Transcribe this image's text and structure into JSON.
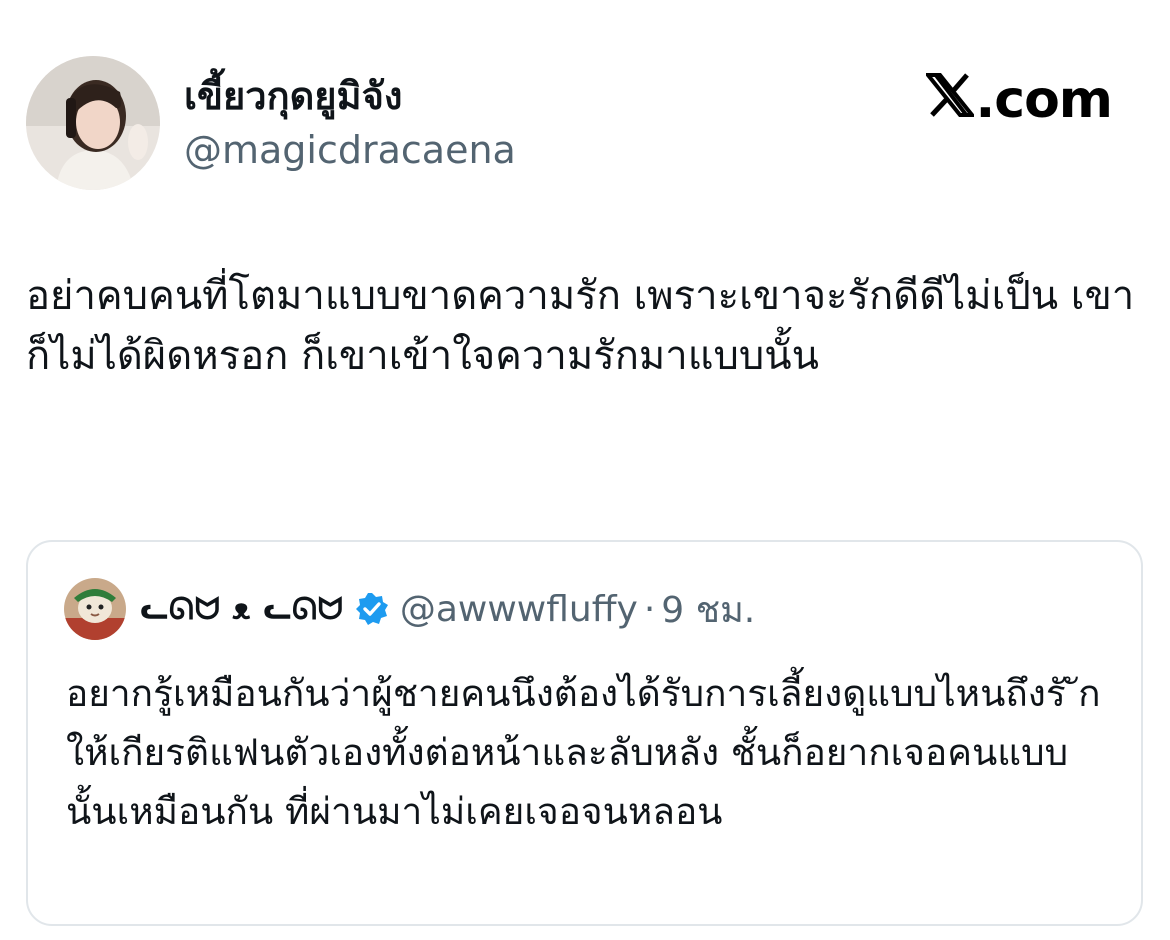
{
  "tweet": {
    "display_name": "เขี้ยวกุดยูมิจัง",
    "handle": "@magicdracaena",
    "source_label": ".com",
    "text": "อย่าคบคนที่โตมาแบบขาดความรัก เพราะเขาจะรักดีดีไม่เป็น เขาก็ไม่ได้ผิดหรอก ก็เขาเข้าใจความรักมาแบบนั้น"
  },
  "quoted_tweet": {
    "display_name": "ᓚᘏᗢ ᴥ ᓚᘏᗢ",
    "handle": "@awwwfluffy",
    "separator": "·",
    "time": "9 ชม.",
    "text": "อยากรู้เหมือนกันว่าผู้ชายคนนึงต้องได้รับการเลี้ยงดูแบบไหนถึงรั ัก ให้เกียรติแฟนตัวเองทั้งต่อหน้าและลับหลัง ชั้นก็อยากเจอคนแบบนั้นเหมือนกัน ที่ผ่านมาไม่เคยเจอจนหลอน"
  },
  "icons": {
    "brand": "x-logo-icon",
    "verified": "verified-badge-icon"
  },
  "colors": {
    "text_primary": "#0f1419",
    "text_secondary": "#536471",
    "verified_blue": "#1d9bf0",
    "quote_border": "#e1e6ea"
  }
}
